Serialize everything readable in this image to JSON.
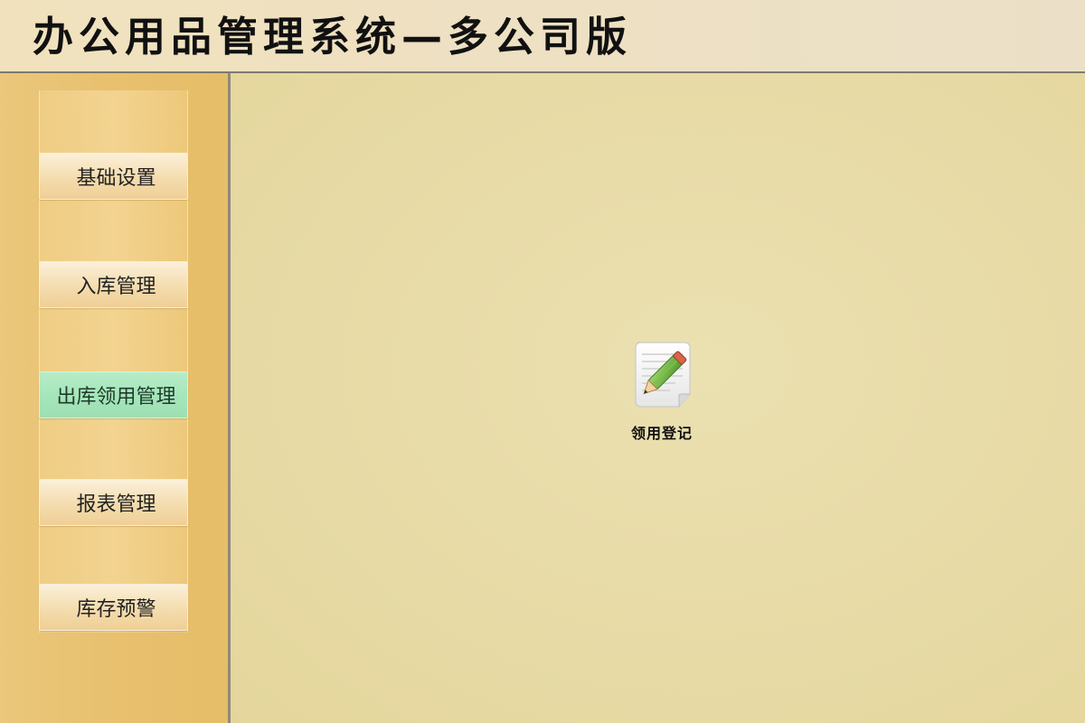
{
  "header": {
    "title": "办公用品管理系统—多公司版"
  },
  "sidebar": {
    "items": [
      {
        "label": "基础设置",
        "active": false
      },
      {
        "label": "入库管理",
        "active": false
      },
      {
        "label": "出库领用管理",
        "active": true
      },
      {
        "label": "报表管理",
        "active": false
      },
      {
        "label": "库存预警",
        "active": false
      }
    ]
  },
  "main": {
    "shortcuts": [
      {
        "label": "领用登记",
        "icon": "notepad-pencil-icon"
      }
    ]
  },
  "colors": {
    "header_bg": "#efe1c0",
    "sidebar_bg": "#e8c06e",
    "main_bg": "#e8dba7",
    "active_item": "#a5e6bb"
  }
}
